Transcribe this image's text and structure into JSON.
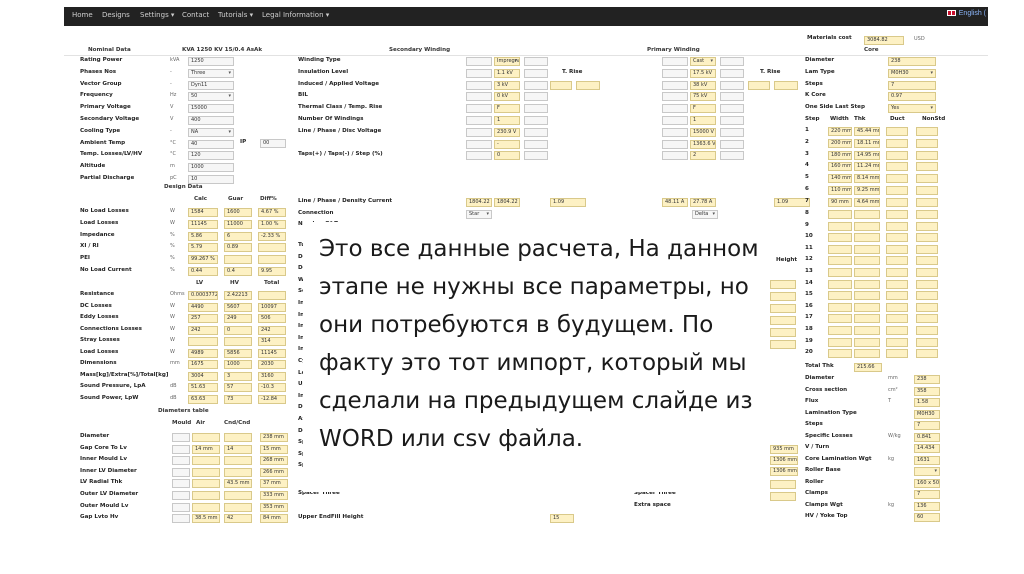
{
  "nav": {
    "items": [
      "Home",
      "Designs",
      "Settings ▾",
      "Contact",
      "Tutorials ▾",
      "Legal Information ▾"
    ],
    "language": "English ("
  },
  "header": {
    "materials_cost_label": "Materials cost",
    "materials_cost_value": "3084.82",
    "currency": "USD"
  },
  "sections": {
    "nominal": "Nominal Data",
    "nominal_title": "KVA 1250 KV 15/0.4 AsAk",
    "secondary": "Secondary Winding",
    "primary": "Primary Winding",
    "core": "Core",
    "design": "Design Data",
    "diameters": "Diameters table"
  },
  "nominal_rows": [
    {
      "label": "Rating Power",
      "unit": "kVA",
      "value": "1250"
    },
    {
      "label": "Phases Nos",
      "unit": "-",
      "value": "Three"
    },
    {
      "label": "Vector Group",
      "unit": "-",
      "value": "Dyn11"
    },
    {
      "label": "Frequency",
      "unit": "Hz",
      "value": "50"
    },
    {
      "label": "Primary Voltage",
      "unit": "V",
      "value": "15000"
    },
    {
      "label": "Secondary Voltage",
      "unit": "V",
      "value": "400"
    },
    {
      "label": "Cooling Type",
      "unit": "-",
      "value": "NA"
    },
    {
      "label": "Ambient Temp",
      "unit": "°C",
      "value": "40"
    },
    {
      "label": "Temp. Losses/LV/HV",
      "unit": "°C",
      "value": "120"
    },
    {
      "label": "Altitude",
      "unit": "m",
      "value": "1000"
    },
    {
      "label": "Partial Discharge",
      "unit": "pC",
      "value": "10"
    }
  ],
  "ip": {
    "label": "IP",
    "value": "00"
  },
  "design_headers": [
    "Calc",
    "Guar",
    "Diff%"
  ],
  "design_rows": [
    {
      "label": "No Load Losses",
      "unit": "W",
      "calc": "1584",
      "guar": "1600",
      "diff": "4.67 %"
    },
    {
      "label": "Load Losses",
      "unit": "W",
      "calc": "11145",
      "guar": "11000",
      "diff": "1.00 %"
    },
    {
      "label": "Impedance",
      "unit": "%",
      "calc": "5.86",
      "guar": "6",
      "diff": "-2.33 %"
    },
    {
      "label": "XI / RI",
      "unit": "%",
      "calc": "5.79",
      "guar": "0.89",
      "diff": ""
    },
    {
      "label": "PEI",
      "unit": "%",
      "calc": "99.267 %",
      "guar": "",
      "diff": ""
    },
    {
      "label": "No Load Current",
      "unit": "%",
      "calc": "0.44",
      "guar": "0.4",
      "diff": "9.95"
    }
  ],
  "lvhv_headers": [
    "LV",
    "HV",
    "Total"
  ],
  "lvhv_rows": [
    {
      "label": "Resistance",
      "unit": "Ohms",
      "lv": "0.0003772",
      "hv": "2.42213",
      "total": ""
    },
    {
      "label": "DC Losses",
      "unit": "W",
      "lv": "4490",
      "hv": "5607",
      "total": "10097"
    },
    {
      "label": "Eddy Losses",
      "unit": "W",
      "lv": "257",
      "hv": "249",
      "total": "506"
    },
    {
      "label": "Connections Losses",
      "unit": "W",
      "lv": "242",
      "hv": "0",
      "total": "242"
    },
    {
      "label": "Stray Losses",
      "unit": "W",
      "lv": "",
      "hv": "",
      "total": "314"
    },
    {
      "label": "Load Losses",
      "unit": "W",
      "lv": "4989",
      "hv": "5856",
      "total": "11145"
    },
    {
      "label": "Dimensions",
      "unit": "mm",
      "lv": "1675",
      "hv": "1000",
      "total": "2030"
    },
    {
      "label": "Mass[kg]/Extra[%]/Total[kg]",
      "unit": "",
      "lv": "3004",
      "hv": "3",
      "total": "3160"
    },
    {
      "label": "Sound Pressure, LpA",
      "unit": "dB",
      "lv": "51.63",
      "hv": "57",
      "total": "-10.3"
    },
    {
      "label": "Sound Power, LpW",
      "unit": "dB",
      "lv": "63.63",
      "hv": "73",
      "total": "-12.84"
    }
  ],
  "diam_headers": [
    "Mould",
    "Air",
    "Cnd/Cnd"
  ],
  "diam_rows": [
    {
      "label": "Diameter",
      "a": "",
      "b": "",
      "c": "",
      "d": "238 mm"
    },
    {
      "label": "Gap Core To Lv",
      "a": "",
      "b": "14 mm",
      "c": "14",
      "d": "15 mm"
    },
    {
      "label": "Inner Mould Lv",
      "a": "",
      "b": "",
      "c": "",
      "d": "268 mm"
    },
    {
      "label": "Inner LV Diameter",
      "a": "",
      "b": "",
      "c": "",
      "d": "266 mm"
    },
    {
      "label": "LV Radial Thk",
      "a": "",
      "b": "",
      "c": "43.5 mm",
      "d": "37 mm"
    },
    {
      "label": "Outer LV Diameter",
      "a": "",
      "b": "",
      "c": "",
      "d": "333 mm"
    },
    {
      "label": "Outer Mould Lv",
      "a": "",
      "b": "",
      "c": "",
      "d": "353 mm"
    },
    {
      "label": "Gap Lvto Hv",
      "a": "",
      "b": "38.5 mm",
      "c": "42",
      "d": "84 mm"
    }
  ],
  "winding_rows": [
    {
      "label": "Winding Type",
      "sec": "Impregnated",
      "pri": "Cast"
    },
    {
      "label": "Insulation Level",
      "sec": "1.1 kV",
      "pri": "17.5 kV"
    },
    {
      "label": "Induced / Applied Voltage",
      "sec": "3 kV",
      "pri": "38 kV"
    },
    {
      "label": "BIL",
      "sec": "0 kV",
      "pri": "75 kV"
    },
    {
      "label": "Thermal Class / Temp. Rise",
      "sec": "F",
      "pri": "F"
    },
    {
      "label": "Number Of Windings",
      "sec": "1",
      "pri": "1"
    },
    {
      "label": "Line / Phase / Disc Voltage",
      "sec": "230.9 V",
      "pri": "15000 V"
    },
    {
      "label": "",
      "sec": "-",
      "pri": "1363.6 V"
    },
    {
      "label": "Taps(+) / Taps(-) / Step (%)",
      "sec": "0",
      "pri": "2"
    }
  ],
  "trise_label": "T. Rise",
  "current_label": "Line / Phase / Density Current",
  "current_values": {
    "sec": "1804.22 A",
    "sec2": "1804.22 A",
    "sec3": "1.09",
    "pri": "48.11 A",
    "pri2": "27.78 A",
    "pri3": "1.09"
  },
  "connection": {
    "label": "Connection",
    "sec": "Star",
    "pri": "Delta"
  },
  "turns_label": "Number Of Turns",
  "lower_left_partial": [
    "Turn",
    "Desc",
    "Desc",
    "Weig",
    "Secti",
    "Insu",
    "Inter",
    "Inter",
    "Inne",
    "Inne",
    "Cylin",
    "Lowe",
    "Uppe",
    "Inne",
    "Duct",
    "Axial",
    "Desc",
    "Spac",
    "Spac",
    "Spac"
  ],
  "spacer_three": "Spacer Three",
  "upper_endfill": {
    "label": "Upper EndFill Height",
    "value": "15"
  },
  "extra_space": "Extra space",
  "core_rows": [
    {
      "label": "Diameter",
      "unit": "",
      "value": "238"
    },
    {
      "label": "Lam Type",
      "unit": "",
      "value": "M0H30"
    },
    {
      "label": "Steps",
      "unit": "",
      "value": "7"
    },
    {
      "label": "K Core",
      "unit": "",
      "value": "0.97"
    },
    {
      "label": "One Side Last Step",
      "unit": "",
      "value": "Yes"
    }
  ],
  "step_headers": [
    "Step",
    "Width",
    "Thk",
    "Duct",
    "NonStd"
  ],
  "steps": [
    {
      "n": "1",
      "w": "220 mm",
      "t": "45.44 mm"
    },
    {
      "n": "2",
      "w": "200 mm",
      "t": "18.11 mm"
    },
    {
      "n": "3",
      "w": "180 mm",
      "t": "14.95 mm"
    },
    {
      "n": "4",
      "w": "160 mm",
      "t": "11.24 mm"
    },
    {
      "n": "5",
      "w": "140 mm",
      "t": "8.14 mm"
    },
    {
      "n": "6",
      "w": "110 mm",
      "t": "9.25 mm"
    },
    {
      "n": "7",
      "w": "90 mm",
      "t": "4.64 mm"
    }
  ],
  "more_steps": [
    "8",
    "9",
    "10",
    "11",
    "12",
    "13",
    "14",
    "15",
    "16",
    "17",
    "18",
    "19",
    "20"
  ],
  "height_label": "Height",
  "total_thk": {
    "label": "Total Thk",
    "value": "215.66"
  },
  "core_lower": [
    {
      "label": "Diameter",
      "unit": "mm",
      "value": "238"
    },
    {
      "label": "Cross section",
      "unit": "cm²",
      "value": "358"
    },
    {
      "label": "Flux",
      "unit": "T",
      "value": "1.58"
    },
    {
      "label": "Lamination Type",
      "unit": "",
      "value": "M0H30"
    },
    {
      "label": "Steps",
      "unit": "",
      "value": "7"
    },
    {
      "label": "Specific Losses",
      "unit": "W/kg",
      "value": "0.841"
    },
    {
      "label": "V / Turn",
      "unit": "",
      "value": "14.434"
    },
    {
      "label": "Core Lamination Wgt",
      "unit": "kg",
      "value": "1631"
    },
    {
      "label": "Roller Base",
      "unit": "",
      "value": ""
    },
    {
      "label": "Roller",
      "unit": "",
      "value": "160 x 50 - NY"
    },
    {
      "label": "Clamps",
      "unit": "",
      "value": "7"
    },
    {
      "label": "Clamps Wgt",
      "unit": "kg",
      "value": "136"
    },
    {
      "label": "HV / Yoke Top",
      "unit": "",
      "value": "60"
    }
  ],
  "mid_values": [
    "935 mm",
    "1306 mm",
    "1306 mm"
  ],
  "overlay": {
    "text": "Это все данные расчета, На данном этапе не нужны все параметры, но они потребуются в будущем. По факту это тот импорт, который мы сделали на предыдущем слайде из WORD или csv файла."
  }
}
